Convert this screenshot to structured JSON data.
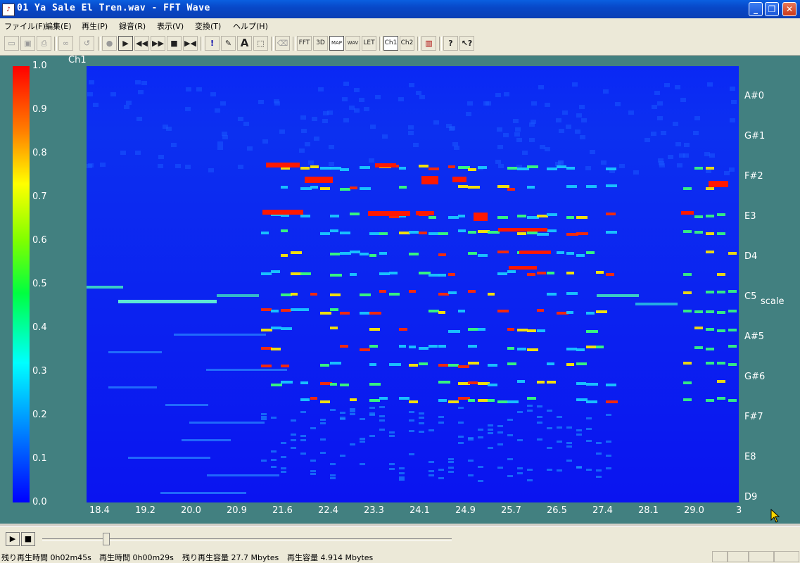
{
  "window": {
    "title": "01 Ya Sale El Tren.wav - FFT Wave",
    "minimize_label": "_",
    "maximize_label": "❐",
    "close_label": "✕"
  },
  "menu": [
    "ファイル(F)",
    "編集(E)",
    "再生(P)",
    "録音(R)",
    "表示(V)",
    "変換(T)",
    "ヘルプ(H)"
  ],
  "toolbar": {
    "fft": "FFT",
    "three_d": "3D",
    "map": "MAP",
    "wav": "WAV",
    "let": "LET",
    "ch1": "Ch1",
    "ch2": "Ch2"
  },
  "channel_label": "Ch1",
  "colorbar_ticks": [
    "1.0",
    "0.9",
    "0.8",
    "0.7",
    "0.6",
    "0.5",
    "0.4",
    "0.3",
    "0.2",
    "0.1",
    "0.0"
  ],
  "x_ticks": [
    "18.4",
    "19.2",
    "20.0",
    "20.9",
    "21.6",
    "22.4",
    "23.3",
    "24.1",
    "24.9",
    "25.7",
    "26.5",
    "27.4",
    "28.1",
    "29.0",
    "3"
  ],
  "y_ticks": [
    "A#0",
    "G#1",
    "F#2",
    "E3",
    "D4",
    "C5",
    "A#5",
    "G#6",
    "F#7",
    "E8",
    "D9"
  ],
  "axis_label": "scale",
  "status": {
    "remaining_time": "残り再生時間 0h02m45s",
    "play_time": "再生時間 0h00m29s",
    "remaining_size": "残り再生容量 27.7 Mbytes",
    "play_size": "再生容量 4.914 Mbytes"
  },
  "colors": {
    "titlebar": "#0a4fd0",
    "plot_background": "#428080",
    "spectrogram_base": "#0a1ef0"
  }
}
